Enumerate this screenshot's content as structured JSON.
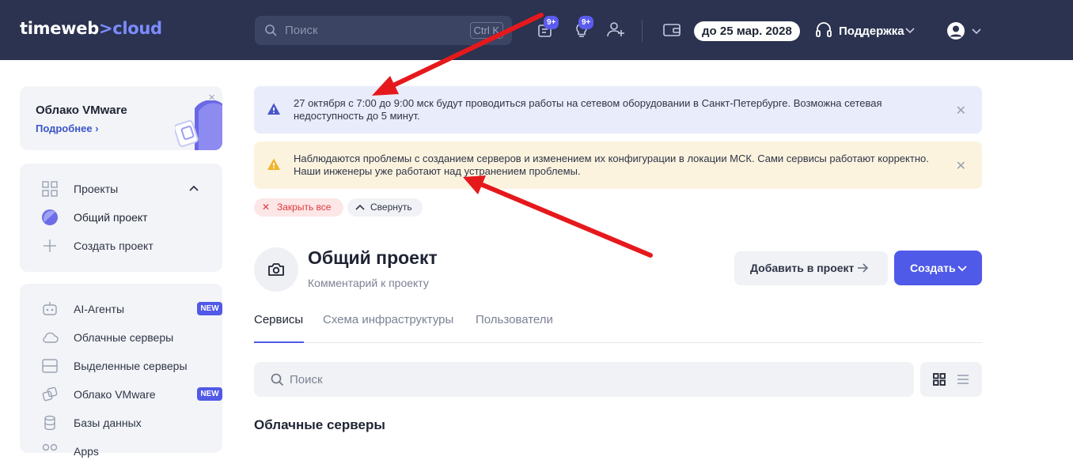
{
  "header": {
    "logo_main": "timeweb",
    "logo_arrow": ">",
    "logo_cloud": "cloud",
    "search_placeholder": "Поиск",
    "search_shortcut": "Ctrl K",
    "notifications_badge": "9+",
    "ideas_badge": "9+",
    "balance": "до 25 мар. 2028",
    "support_label": "Поддержка",
    "icons": [
      "search-icon",
      "docs-icon",
      "lightbulb-icon",
      "add-user-icon",
      "wallet-icon",
      "headset-icon",
      "user-avatar-icon",
      "chevron-down-icon"
    ]
  },
  "promo": {
    "title": "Облако VMware",
    "link": "Подробнее ›",
    "close": "×"
  },
  "sidebar": {
    "projects": [
      {
        "label": "Проекты",
        "icon": "grid-icon"
      },
      {
        "label": "Общий проект",
        "icon": "project-avatar-icon"
      },
      {
        "label": "Создать проект",
        "icon": "plus-icon"
      }
    ],
    "services": [
      {
        "label": "AI-Агенты",
        "icon": "robot-icon",
        "badge": "NEW"
      },
      {
        "label": "Облачные серверы",
        "icon": "cloud-icon"
      },
      {
        "label": "Выделенные серверы",
        "icon": "server-icon"
      },
      {
        "label": "Облако VMware",
        "icon": "vmware-icon",
        "badge": "NEW"
      },
      {
        "label": "Базы данных",
        "icon": "database-icon"
      },
      {
        "label": "Apps",
        "icon": "apps-icon"
      }
    ]
  },
  "alerts": [
    {
      "type": "info",
      "text": "27 октября с 7:00 до 9:00 мск будут проводиться работы на сетевом оборудовании в Санкт-Петербурге. Возможна сетевая недоступность до 5 минут.",
      "color": "#4a55c9"
    },
    {
      "type": "warning",
      "text": "Наблюдаются проблемы с созданием серверов и изменением их конфигурации в локации МСК. Сами сервисы работают корректно. Наши инженеры уже работают над устранением проблемы.",
      "color": "#f0b429"
    }
  ],
  "alert_actions": {
    "close_all": "Закрыть все",
    "collapse": "Свернуть"
  },
  "project": {
    "title": "Общий проект",
    "comment": "Комментарий к проекту",
    "add_button": "Добавить в проект",
    "create_button": "Создать"
  },
  "tabs": [
    "Сервисы",
    "Схема инфраструктуры",
    "Пользователи"
  ],
  "content_search_placeholder": "Поиск",
  "section_title": "Облачные серверы",
  "colors": {
    "header_bg": "#2b3350",
    "accent": "#4f5ae8",
    "annotation_arrow": "#e5191c"
  }
}
